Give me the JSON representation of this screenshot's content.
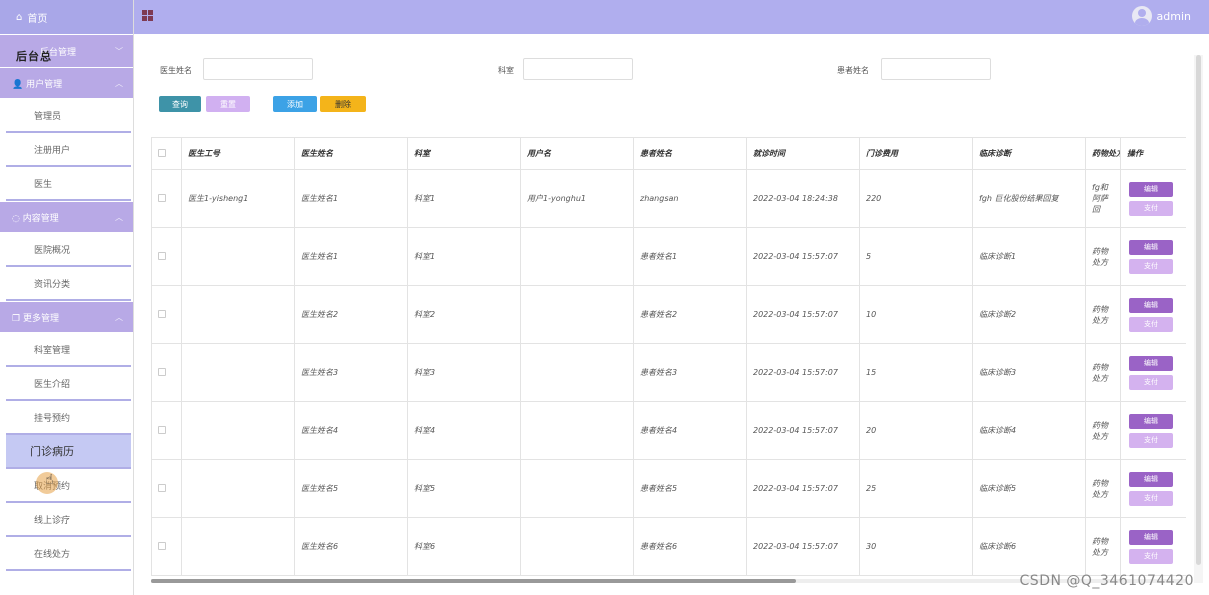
{
  "sidebar": {
    "home": "首页",
    "groups": [
      {
        "label": "后台管理"
      },
      {
        "label": "用户管理",
        "items": [
          "管理员",
          "注册用户",
          "医生"
        ]
      },
      {
        "label": "内容管理",
        "items": [
          "医院概况",
          "资讯分类"
        ]
      },
      {
        "label": "更多管理",
        "items": [
          "科室管理",
          "医生介绍",
          "挂号预约",
          "门诊病历",
          "取消预约",
          "线上诊疗",
          "在线处方"
        ]
      }
    ],
    "overlap_label": "后台总",
    "active_item": "门诊病历"
  },
  "topbar": {
    "user": "admin"
  },
  "search": {
    "doctor_name_label": "医生姓名",
    "dept_label": "科室",
    "patient_name_label": "患者姓名",
    "doctor_name_value": "",
    "dept_value": "",
    "patient_name_value": "",
    "query_btn": "查询",
    "reset_btn": "重置",
    "add_btn": "添加",
    "delete_btn": "删除"
  },
  "table": {
    "headers": [
      "医生工号",
      "医生姓名",
      "科室",
      "用户名",
      "患者姓名",
      "就诊时间",
      "门诊费用",
      "临床诊断",
      "药物处方",
      "操作"
    ],
    "edit_label": "编辑",
    "pay_label": "支付",
    "rows": [
      [
        "医生1-yisheng1",
        "医生姓名1",
        "科室1",
        "用户1-yonghu1",
        "zhangsan",
        "2022-03-04 18:24:38",
        "220",
        "fgh 巨化股份结果回复",
        "fg和阿萨回"
      ],
      [
        "",
        "医生姓名1",
        "科室1",
        "",
        "患者姓名1",
        "2022-03-04 15:57:07",
        "5",
        "临床诊断1",
        "药物处方"
      ],
      [
        "",
        "医生姓名2",
        "科室2",
        "",
        "患者姓名2",
        "2022-03-04 15:57:07",
        "10",
        "临床诊断2",
        "药物处方"
      ],
      [
        "",
        "医生姓名3",
        "科室3",
        "",
        "患者姓名3",
        "2022-03-04 15:57:07",
        "15",
        "临床诊断3",
        "药物处方"
      ],
      [
        "",
        "医生姓名4",
        "科室4",
        "",
        "患者姓名4",
        "2022-03-04 15:57:07",
        "20",
        "临床诊断4",
        "药物处方"
      ],
      [
        "",
        "医生姓名5",
        "科室5",
        "",
        "患者姓名5",
        "2022-03-04 15:57:07",
        "25",
        "临床诊断5",
        "药物处方"
      ],
      [
        "",
        "医生姓名6",
        "科室6",
        "",
        "患者姓名6",
        "2022-03-04 15:57:07",
        "30",
        "临床诊断6",
        "药物处方"
      ]
    ]
  },
  "watermark": "CSDN @Q_3461074420",
  "colors": {
    "topbar": "#b0aeee",
    "group": "#b8a9e6",
    "edit": "#9a63c6",
    "pay": "#d4b2ef"
  }
}
